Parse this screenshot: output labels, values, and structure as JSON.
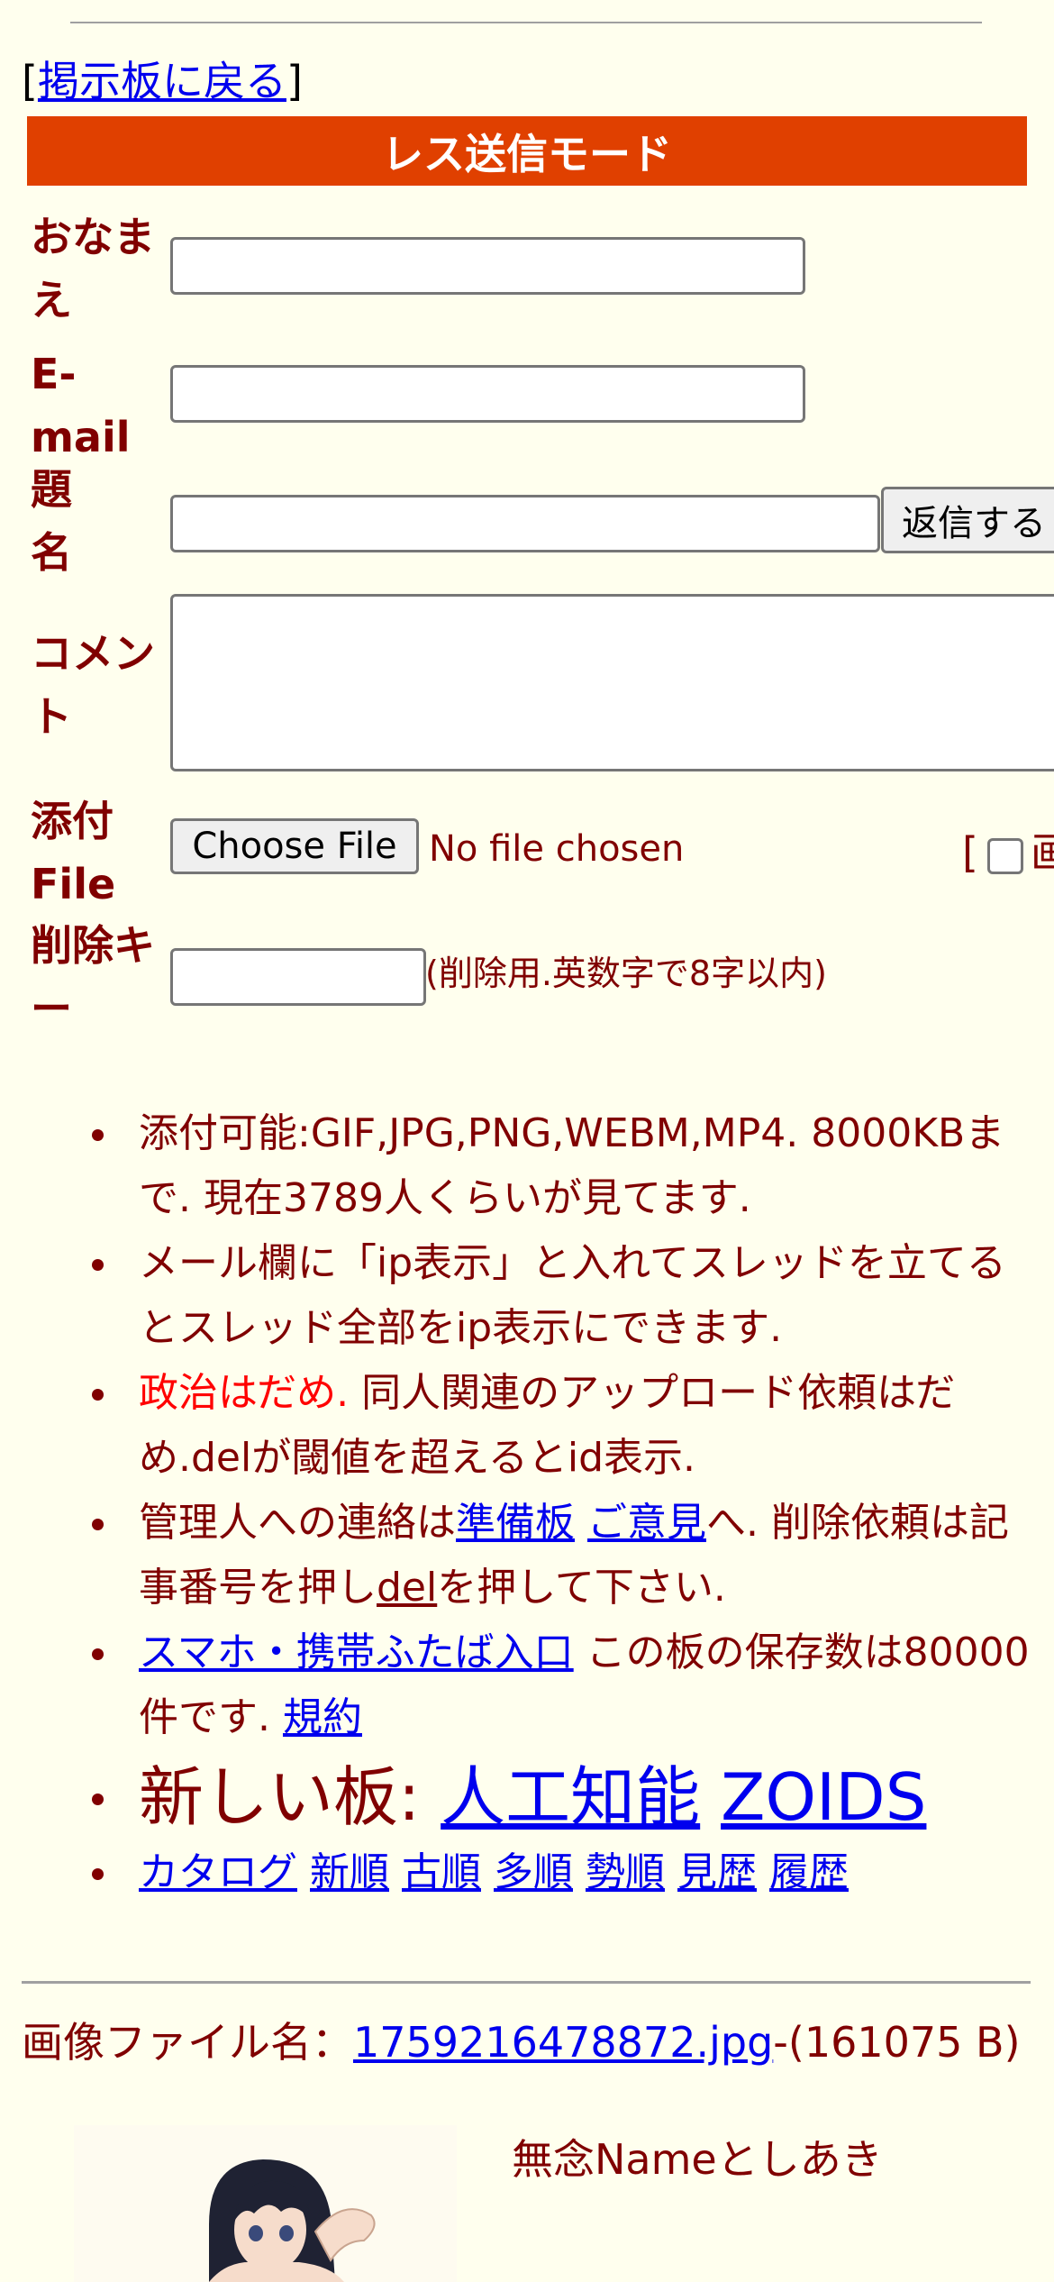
{
  "nav": {
    "back_open": "[",
    "back_label": "掲示板に戻る",
    "back_close": "]"
  },
  "form": {
    "header": "レス送信モード",
    "name_label": "おなまえ",
    "email_label": "E-mail",
    "subject_label": "題名",
    "submit_label": "返信する",
    "comment_label": "コメント",
    "attach_label": "添付File",
    "choose_file_label": "Choose File",
    "no_file_text": "No file chosen",
    "image_option_partial": "[",
    "image_option_glyph": "画",
    "delete_key_label": "削除キー",
    "delete_key_hint": "(削除用.英数字で8字以内)"
  },
  "rules": {
    "r1": "添付可能:GIF,JPG,PNG,WEBM,MP4. 8000KBまで. 現在3789人くらいが見てます.",
    "r2": "メール欄に「ip表示」と入れてスレッドを立てるとスレッド全部をip表示にできます.",
    "r3_red": "政治はだめ.",
    "r3_rest": " 同人関連のアップロード依頼はだめ.delが閾値を超えるとid表示.",
    "r4_pre": "管理人への連絡は",
    "r4_link1": "準備板",
    "r4_link2": "ご意見",
    "r4_mid": "へ. 削除依頼は記事番号を押し",
    "r4_link3": "del",
    "r4_post": "を押して下さい.",
    "r5_link": "スマホ・携帯ふたば入口",
    "r5_mid": " この板の保存数は80000件です. ",
    "r5_link2": "規約",
    "new_boards_label": "新しい板: ",
    "new_board_1": "人工知能",
    "new_board_2": "ZOIDS",
    "sort_links": [
      "カタログ",
      "新順",
      "古順",
      "多順",
      "勢順",
      "見歴",
      "履歴"
    ]
  },
  "post": {
    "file_label": "画像ファイル名：",
    "file_name": "1759216478872.jpg",
    "file_size": "-(161075 B)",
    "poster_name": "無念Nameとしあき"
  }
}
